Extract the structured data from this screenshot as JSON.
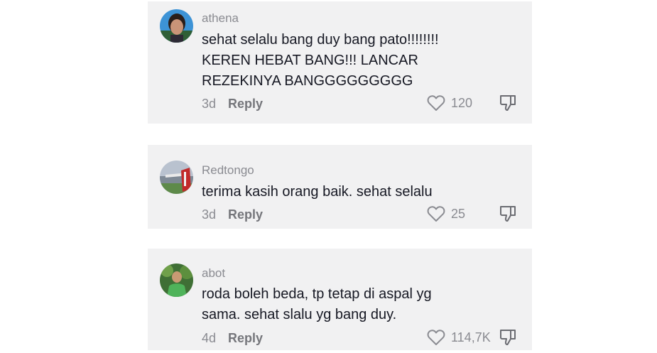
{
  "comments": [
    {
      "username": "athena",
      "text_lines": [
        "sehat selalu bang duy bang pato!!!!!!!!",
        "KEREN HEBAT BANG!!! LANCAR",
        "REZEKINYA BANGGGGGGGGG"
      ],
      "age": "3d",
      "reply_label": "Reply",
      "likes": "120"
    },
    {
      "username": "Redtongo",
      "text_lines": [
        "terima kasih orang baik. sehat selalu"
      ],
      "age": "3d",
      "reply_label": "Reply",
      "likes": "25"
    },
    {
      "username": "abot",
      "text_lines": [
        "roda boleh beda, tp tetap di aspal yg",
        "sama. sehat slalu yg bang duy."
      ],
      "age": "4d",
      "reply_label": "Reply",
      "likes": "114,7K"
    }
  ],
  "icons": {
    "like": "heart-outline-icon",
    "dislike": "thumbs-down-outline-icon"
  },
  "colors": {
    "card_bg": "#f1f1f2",
    "text": "#161823",
    "muted": "#8a8b91"
  }
}
